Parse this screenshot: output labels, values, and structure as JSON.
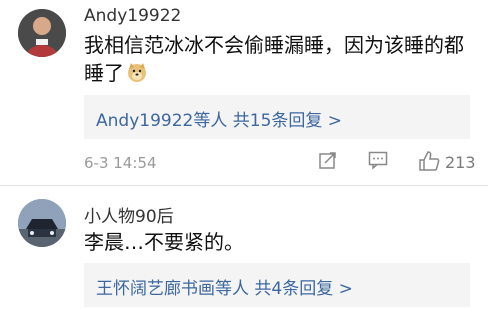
{
  "comments": [
    {
      "username": "Andy19922",
      "text_line1": "我相信范冰冰不会偷睡漏睡，因为该睡的都",
      "text_line2": "睡了",
      "emoji_icon": "doge-emoji-icon",
      "reply_summary": {
        "names": "Andy19922等人",
        "count": "共15条回复",
        "chevron": ">"
      },
      "date": "6-3 14:54",
      "actions": {
        "share_icon": "share-icon",
        "comment_icon": "comment-icon",
        "like_icon": "like-icon",
        "like_count": "213"
      }
    },
    {
      "username": "小人物90后",
      "text": "李晨…不要紧的。",
      "reply_summary": {
        "names": "王怀阔艺廊书画等人",
        "count": "共4条回复",
        "chevron": ">"
      }
    }
  ],
  "colors": {
    "link_blue": "#3c67a0",
    "reply_bg": "#f4f4f4",
    "meta_gray": "#9a9a9a"
  }
}
